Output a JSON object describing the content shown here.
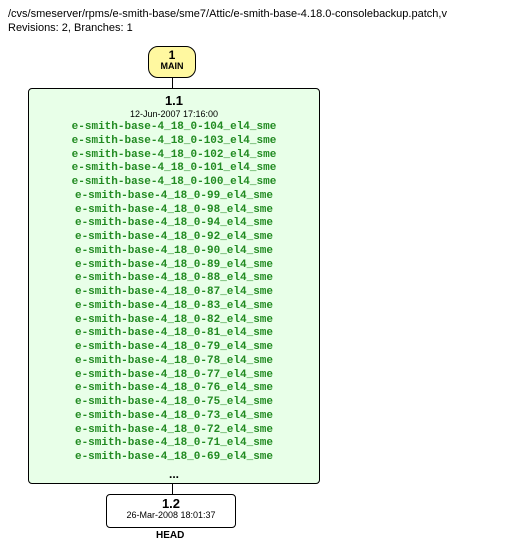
{
  "header": {
    "path": "/cvs/smeserver/rpms/e-smith-base/sme7/Attic/e-smith-base-4.18.0-consolebackup.patch,v",
    "revisions": "Revisions: 2, Branches: 1"
  },
  "main_branch": {
    "number": "1",
    "label": "MAIN"
  },
  "revision1": {
    "version": "1.1",
    "date": "12-Jun-2007 17:16:00",
    "tags": [
      "e-smith-base-4_18_0-104_el4_sme",
      "e-smith-base-4_18_0-103_el4_sme",
      "e-smith-base-4_18_0-102_el4_sme",
      "e-smith-base-4_18_0-101_el4_sme",
      "e-smith-base-4_18_0-100_el4_sme",
      "e-smith-base-4_18_0-99_el4_sme",
      "e-smith-base-4_18_0-98_el4_sme",
      "e-smith-base-4_18_0-94_el4_sme",
      "e-smith-base-4_18_0-92_el4_sme",
      "e-smith-base-4_18_0-90_el4_sme",
      "e-smith-base-4_18_0-89_el4_sme",
      "e-smith-base-4_18_0-88_el4_sme",
      "e-smith-base-4_18_0-87_el4_sme",
      "e-smith-base-4_18_0-83_el4_sme",
      "e-smith-base-4_18_0-82_el4_sme",
      "e-smith-base-4_18_0-81_el4_sme",
      "e-smith-base-4_18_0-79_el4_sme",
      "e-smith-base-4_18_0-78_el4_sme",
      "e-smith-base-4_18_0-77_el4_sme",
      "e-smith-base-4_18_0-76_el4_sme",
      "e-smith-base-4_18_0-75_el4_sme",
      "e-smith-base-4_18_0-73_el4_sme",
      "e-smith-base-4_18_0-72_el4_sme",
      "e-smith-base-4_18_0-71_el4_sme",
      "e-smith-base-4_18_0-69_el4_sme"
    ],
    "ellipsis": "..."
  },
  "revision2": {
    "version": "1.2",
    "date": "26-Mar-2008 18:01:37"
  },
  "head_label": "HEAD"
}
